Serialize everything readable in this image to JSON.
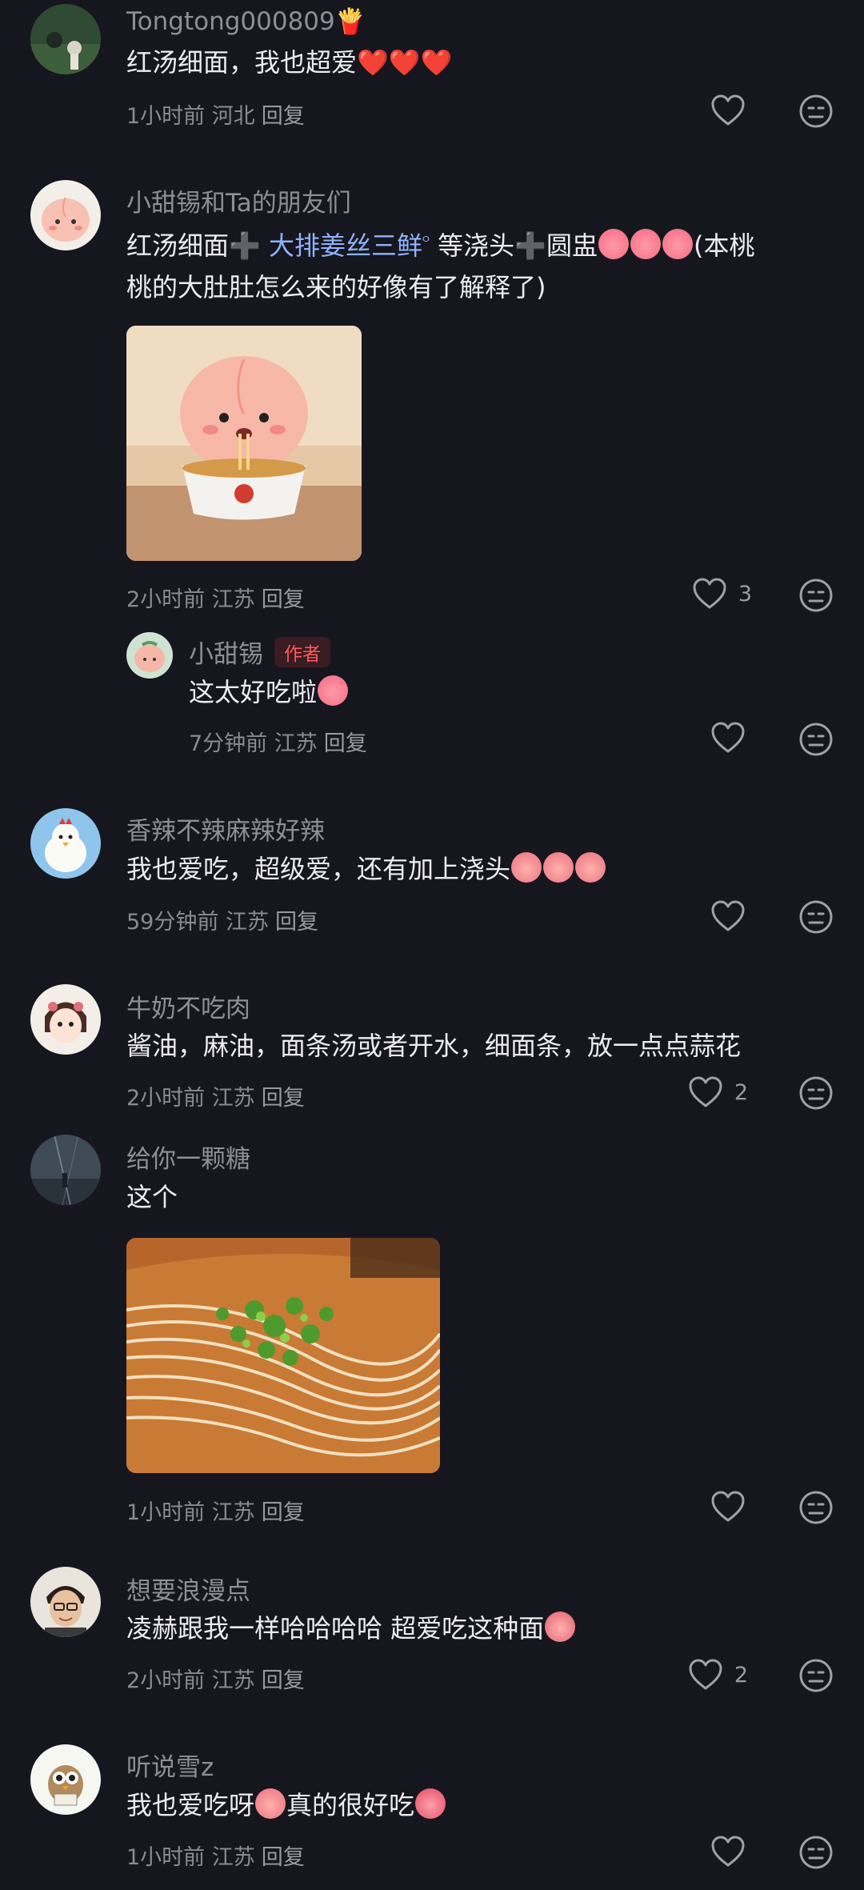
{
  "comments": [
    {
      "name": "Tongtong000809",
      "name_emoji": "🍟",
      "text": "红汤细面，我也超爱",
      "text_emoji": "❤️❤️❤️",
      "time": "1小时前",
      "location": "河北",
      "reply": "回复",
      "likes": ""
    },
    {
      "name": "小甜锡和Ta的朋友们",
      "text_a": "红汤细面",
      "plus_a": "➕",
      "topic": "大排姜丝三鲜",
      "search_icon": "ᴼ",
      "text_b": " 等浇头",
      "plus_b": "➕",
      "text_c": "圆盅",
      "text_d": "(本桃",
      "text_e": "桃的大肚肚怎么来的好像有了解释了)",
      "time": "2小时前",
      "location": "江苏",
      "reply": "回复",
      "likes": "3",
      "reply_thread": {
        "name": "小甜锡",
        "badge": "作者",
        "text": "这太好吃啦",
        "time": "7分钟前",
        "location": "江苏",
        "reply": "回复"
      }
    },
    {
      "name": "香辣不辣麻辣好辣",
      "text": "我也爱吃，超级爱，还有加上浇头",
      "time": "59分钟前",
      "location": "江苏",
      "reply": "回复",
      "likes": ""
    },
    {
      "name": "牛奶不吃肉",
      "text": "酱油，麻油，面条汤或者开水，细面条，放一点点蒜花",
      "time": "2小时前",
      "location": "江苏",
      "reply": "回复",
      "likes": "2"
    },
    {
      "name": "给你一颗糖",
      "text": "这个",
      "time": "1小时前",
      "location": "江苏",
      "reply": "回复",
      "likes": ""
    },
    {
      "name": "想要浪漫点",
      "text": "凌赫跟我一样哈哈哈哈 超爱吃这种面",
      "time": "2小时前",
      "location": "江苏",
      "reply": "回复",
      "likes": "2"
    },
    {
      "name": "听说雪z",
      "text_a": "我也爱吃呀",
      "text_b": "真的很好吃",
      "time": "1小时前",
      "location": "江苏",
      "reply": "回复",
      "likes": ""
    }
  ],
  "icons": {
    "like": "heart-outline-icon",
    "dislike": "meh-face-icon"
  },
  "colors": {
    "background": "#16161e",
    "topic_link": "#8fb4ff",
    "author_badge": "#ff5a5a"
  }
}
